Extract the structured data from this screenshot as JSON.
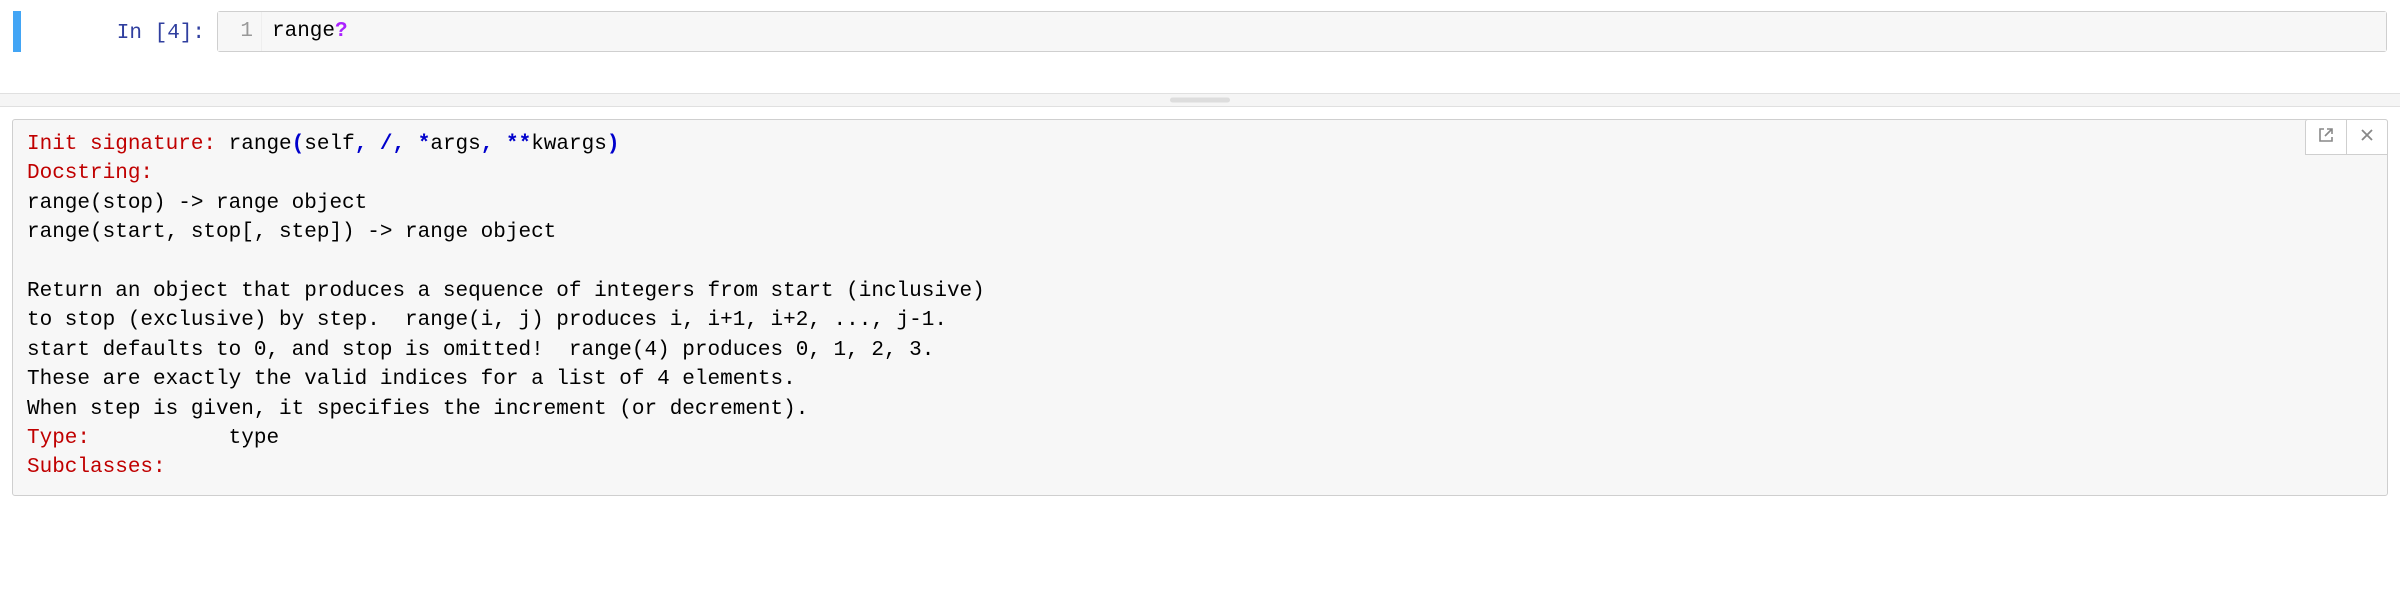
{
  "cell": {
    "prompt": "In [4]:",
    "line_no": "1",
    "code_name": "range",
    "code_q": "?"
  },
  "doc": {
    "line_sig_label": "Init signature:",
    "sig_name": "range",
    "sig_p1": "(",
    "sig_self": "self",
    "sig_c1": ", ",
    "sig_slash": "/",
    "sig_c2": ", ",
    "sig_star": "*",
    "sig_args": "args",
    "sig_c3": ", ",
    "sig_dstar": "**",
    "sig_kwargs": "kwargs",
    "sig_p2": ")",
    "docstring_label": "Docstring:",
    "body": "range(stop) -> range object\nrange(start, stop[, step]) -> range object\n\nReturn an object that produces a sequence of integers from start (inclusive)\nto stop (exclusive) by step.  range(i, j) produces i, i+1, i+2, ..., j-1.\nstart defaults to 0, and stop is omitted!  range(4) produces 0, 1, 2, 3.\nThese are exactly the valid indices for a list of 4 elements.\nWhen step is given, it specifies the increment (or decrement).",
    "type_label": "Type:",
    "type_value": "           type",
    "subclasses_label": "Subclasses:"
  }
}
